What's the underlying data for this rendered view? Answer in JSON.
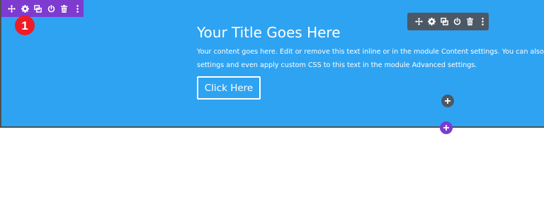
{
  "badge": {
    "number": "1"
  },
  "section_toolbar": {
    "icons": [
      "move-icon",
      "gear-icon",
      "duplicate-icon",
      "power-icon",
      "trash-icon",
      "more-icon"
    ],
    "color": "#7e3bd0"
  },
  "module_toolbar": {
    "icons": [
      "move-icon",
      "gear-icon",
      "duplicate-icon",
      "power-icon",
      "trash-icon",
      "more-icon"
    ],
    "color": "#4c5866"
  },
  "module": {
    "title": "Your Title Goes Here",
    "text_line1": "Your content goes here. Edit or remove this text inline or in the module Content settings. You can also style every as",
    "text_line2": "settings and even apply custom CSS to this text in the module Advanced settings.",
    "button_label": "Click Here"
  },
  "colors": {
    "section_background": "#2ea3f2",
    "badge": "#ee1c25",
    "add_section": "#7e3bd0",
    "add_module": "#4c5866"
  }
}
